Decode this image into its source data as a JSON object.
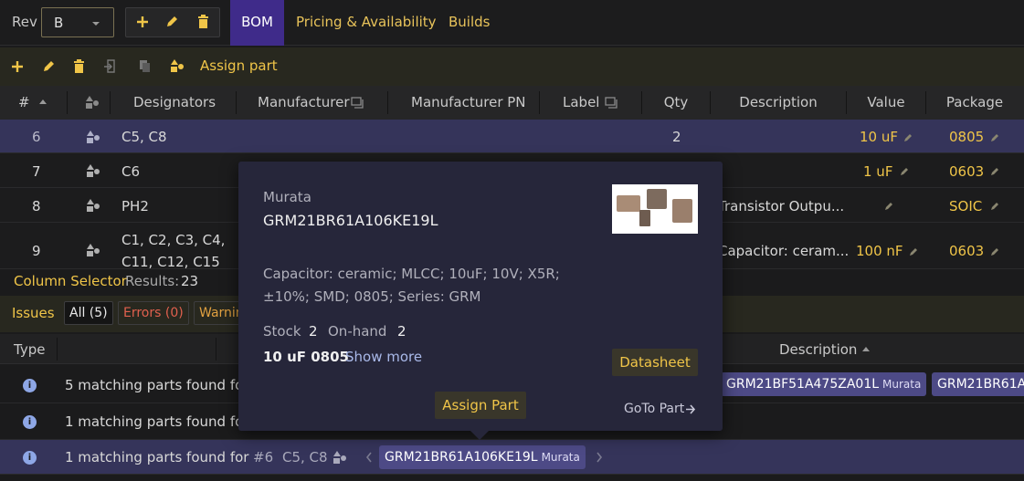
{
  "top": {
    "rev_label": "Rev",
    "rev_value": "B",
    "tabs": [
      {
        "label": "BOM"
      },
      {
        "label": "Pricing & Availability"
      },
      {
        "label": "Builds"
      }
    ]
  },
  "toolbar": {
    "assign_label": "Assign part"
  },
  "table": {
    "headers": {
      "num": "#",
      "designators": "Designators",
      "manufacturer": "Manufacturer",
      "mpn": "Manufacturer PN",
      "label": "Label",
      "qty": "Qty",
      "description": "Description",
      "value": "Value",
      "package": "Package"
    },
    "rows": [
      {
        "num": "6",
        "designators": "C5, C8",
        "qty": "2",
        "description": "",
        "value": "10 uF",
        "package": "0805"
      },
      {
        "num": "7",
        "designators": "C6",
        "qty": "",
        "description": "",
        "value": "1 uF",
        "package": "0603"
      },
      {
        "num": "8",
        "designators": "PH2",
        "qty": "",
        "description": "Transistor Outpu...",
        "value": "",
        "package": "SOIC"
      },
      {
        "num": "9",
        "designators": "C1, C2, C3, C4,",
        "designators2": "C11, C12, C15",
        "qty": "",
        "description": "Capacitor: ceram...",
        "value": "100 nF",
        "package": "0603"
      }
    ]
  },
  "column_selector": {
    "label": "Column Selector",
    "results_label": "Results:",
    "results_count": "23"
  },
  "issues": {
    "title": "Issues",
    "filters": [
      {
        "label": "All (5)"
      },
      {
        "label": "Errors (0)"
      },
      {
        "label": "Warnin"
      }
    ],
    "headers": {
      "type": "Type",
      "description": "Description"
    },
    "rows": [
      {
        "text": "5 matching parts found fo"
      },
      {
        "text": "1 matching parts found fo"
      },
      {
        "text": "1 matching parts found for",
        "ref": "#6",
        "designators": "C5, C8"
      }
    ],
    "chips_row1": [
      {
        "pn": "GRM21BF51A475ZA01L",
        "mfr": "Murata"
      },
      {
        "pn": "GRM21BR61A",
        "mfr": ""
      }
    ],
    "chips_row3": [
      {
        "pn": "GRM21BR61A106KE19L",
        "mfr": "Murata"
      }
    ]
  },
  "popup": {
    "manufacturer": "Murata",
    "part_number": "GRM21BR61A106KE19L",
    "description_line1": "Capacitor: ceramic; MLCC; 10uF; 10V; X5R;",
    "description_line2": "±10%; SMD; 0805; Series: GRM",
    "stock_label": "Stock",
    "stock_value": "2",
    "onhand_label": "On-hand",
    "onhand_value": "2",
    "summary": "10 uF 0805",
    "show_more": "Show more",
    "datasheet": "Datasheet",
    "assign": "Assign Part",
    "goto": "GoTo Part"
  },
  "colors": {
    "accent": "#f0c548",
    "tab_active": "#3f2b8a",
    "selected_row": "#35345a",
    "chip": "#4d4a86",
    "popup_bg": "#26263a"
  }
}
